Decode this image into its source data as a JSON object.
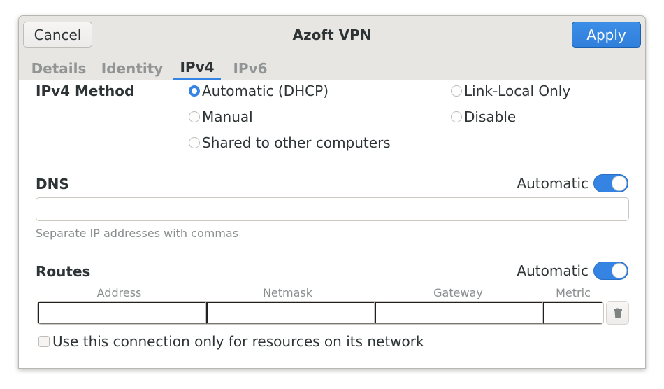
{
  "window": {
    "title": "Azoft VPN",
    "cancel_label": "Cancel",
    "apply_label": "Apply"
  },
  "tabs": [
    {
      "label": "Details",
      "active": false
    },
    {
      "label": "Identity",
      "active": false
    },
    {
      "label": "IPv4",
      "active": true
    },
    {
      "label": "IPv6",
      "active": false
    }
  ],
  "ipv4_method": {
    "label": "IPv4 Method",
    "options": [
      {
        "label": "Automatic (DHCP)",
        "checked": true
      },
      {
        "label": "Manual",
        "checked": false
      },
      {
        "label": "Shared to other computers",
        "checked": false
      },
      {
        "label": "Link-Local Only",
        "checked": false
      },
      {
        "label": "Disable",
        "checked": false
      }
    ]
  },
  "dns": {
    "label": "DNS",
    "automatic_label": "Automatic",
    "automatic_on": true,
    "value": "",
    "hint": "Separate IP addresses with commas"
  },
  "routes": {
    "label": "Routes",
    "automatic_label": "Automatic",
    "automatic_on": true,
    "columns": [
      "Address",
      "Netmask",
      "Gateway",
      "Metric"
    ],
    "row": {
      "address": "",
      "netmask": "",
      "gateway": "",
      "metric": ""
    }
  },
  "only_local_resources": {
    "label": "Use this connection only for resources on its network",
    "checked": false
  },
  "colors": {
    "accent": "#3584e4",
    "headerbar": "#e8e6e3",
    "text": "#2e3436",
    "dim_text": "#929595"
  }
}
